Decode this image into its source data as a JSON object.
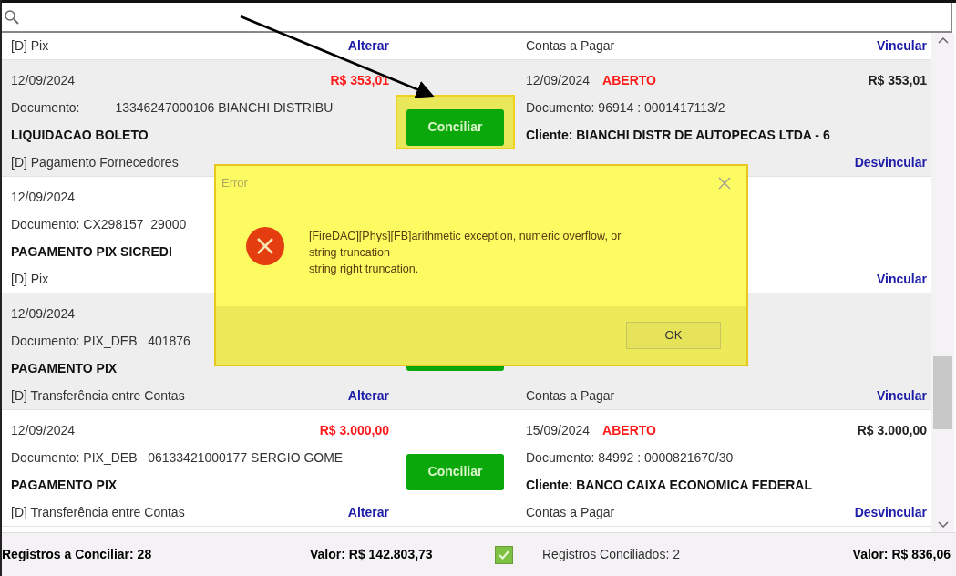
{
  "rows": [
    {
      "clipped": true,
      "shaded": false,
      "left": {
        "category": "[D] Pix",
        "action": "Alterar"
      },
      "right": {
        "category": "Contas a Pagar",
        "action": "Vincular"
      }
    },
    {
      "clipped": false,
      "shaded": true,
      "left": {
        "date": "12/09/2024",
        "amount": "R$ 353,01",
        "document": "Documento:          13346247000106 BIANCHI DISTRIBU",
        "title": "LIQUIDACAO BOLETO",
        "category": "[D] Pagamento Fornecedores"
      },
      "button": {
        "label": "Conciliar",
        "highlighted": true
      },
      "right": {
        "date": "12/09/2024",
        "status": "ABERTO",
        "amount": "R$ 353,01",
        "document": "Documento: 96914 : 0001417113/2",
        "title": "Cliente: BIANCHI DISTR DE AUTOPECAS LTDA - 6",
        "action": "Desvincular"
      }
    },
    {
      "clipped": false,
      "shaded": false,
      "left": {
        "date": "12/09/2024",
        "document": "Documento: CX298157  29000",
        "title": "PAGAMENTO PIX SICREDI",
        "category": "[D] Pix"
      },
      "right": {
        "action": "Vincular"
      }
    },
    {
      "clipped": false,
      "shaded": true,
      "left": {
        "date": "12/09/2024",
        "document": "Documento: PIX_DEB   401876",
        "title": "PAGAMENTO PIX",
        "category": "[D] Transferência entre Contas",
        "action": "Alterar"
      },
      "button": {
        "highlighted": false
      },
      "right": {
        "category": "Contas a Pagar",
        "action": "Vincular"
      }
    },
    {
      "clipped": false,
      "shaded": false,
      "left": {
        "date": "12/09/2024",
        "amount": "R$ 3.000,00",
        "document": "Documento: PIX_DEB   06133421000177 SERGIO GOME",
        "title": "PAGAMENTO PIX",
        "category": "[D] Transferência entre Contas",
        "action": "Alterar"
      },
      "button": {
        "label": "Conciliar",
        "highlighted": false
      },
      "right": {
        "date": "15/09/2024",
        "status": "ABERTO",
        "amount": "R$ 3.000,00",
        "document": "Documento: 84992 : 0000821670/30",
        "title": "Cliente: BANCO CAIXA ECONOMICA FEDERAL",
        "category": "Contas a Pagar",
        "action": "Desvincular"
      }
    }
  ],
  "footer": {
    "pending_count": "Registros a Conciliar: 28",
    "pending_value": "Valor: R$ 142.803,73",
    "checked": true,
    "reconciled_count": "Registros Conciliados: 2",
    "reconciled_value": "Valor: R$ 836,06"
  },
  "dialog": {
    "title": "Error",
    "message_lines": [
      "[FireDAC][Phys][FB]arithmetic exception, numeric overflow, or",
      "string truncation",
      "string right truncation."
    ],
    "button": "OK"
  }
}
